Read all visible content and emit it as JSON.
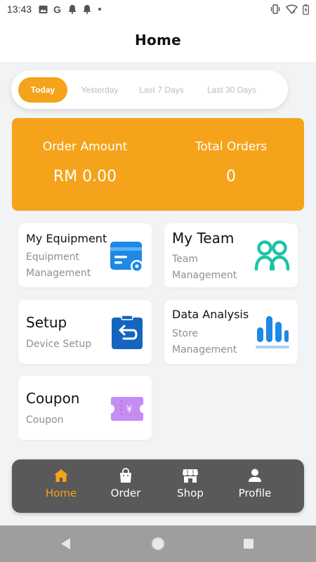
{
  "status_bar": {
    "time": "13:43",
    "icons": [
      "image-icon",
      "google-icon",
      "notification-icon",
      "notification-icon",
      "dot-icon",
      "vibrate-icon",
      "wifi-icon",
      "battery-icon"
    ]
  },
  "header": {
    "title": "Home"
  },
  "filter": {
    "tabs": [
      {
        "label": "Today",
        "active": true
      },
      {
        "label": "Yesterday",
        "active": false
      },
      {
        "label": "Last 7 Days",
        "active": false
      },
      {
        "label": "Last 30 Days",
        "active": false
      }
    ]
  },
  "stats": {
    "order_amount_label": "Order Amount",
    "order_amount_value": "RM 0.00",
    "total_orders_label": "Total Orders",
    "total_orders_value": "0"
  },
  "cards": [
    {
      "title": "My Equipment",
      "subtitle_lines": [
        "Equipment",
        "Management"
      ],
      "icon": "equipment-icon"
    },
    {
      "title": "My Team",
      "subtitle_lines": [
        "Team",
        "Management"
      ],
      "icon": "team-icon"
    },
    {
      "title": "Setup",
      "subtitle_lines": [
        "Device Setup"
      ],
      "icon": "setup-icon"
    },
    {
      "title": "Data Analysis",
      "subtitle_lines": [
        "Store",
        "Management"
      ],
      "icon": "chart-icon"
    },
    {
      "title": "Coupon",
      "subtitle_lines": [
        "Coupon"
      ],
      "icon": "coupon-icon"
    }
  ],
  "nav": {
    "items": [
      {
        "label": "Home",
        "icon": "home-icon",
        "active": true
      },
      {
        "label": "Order",
        "icon": "bag-icon",
        "active": false
      },
      {
        "label": "Shop",
        "icon": "shop-icon",
        "active": false
      },
      {
        "label": "Profile",
        "icon": "user-icon",
        "active": false
      }
    ]
  },
  "colors": {
    "accent": "#f5a31a",
    "nav_bg": "#595959",
    "equipment_blue": "#1e88e5",
    "team_teal": "#1ec3a6",
    "setup_blue": "#1565c0",
    "chart_blue": "#1e88e5",
    "coupon_purple": "#c58cf2"
  }
}
